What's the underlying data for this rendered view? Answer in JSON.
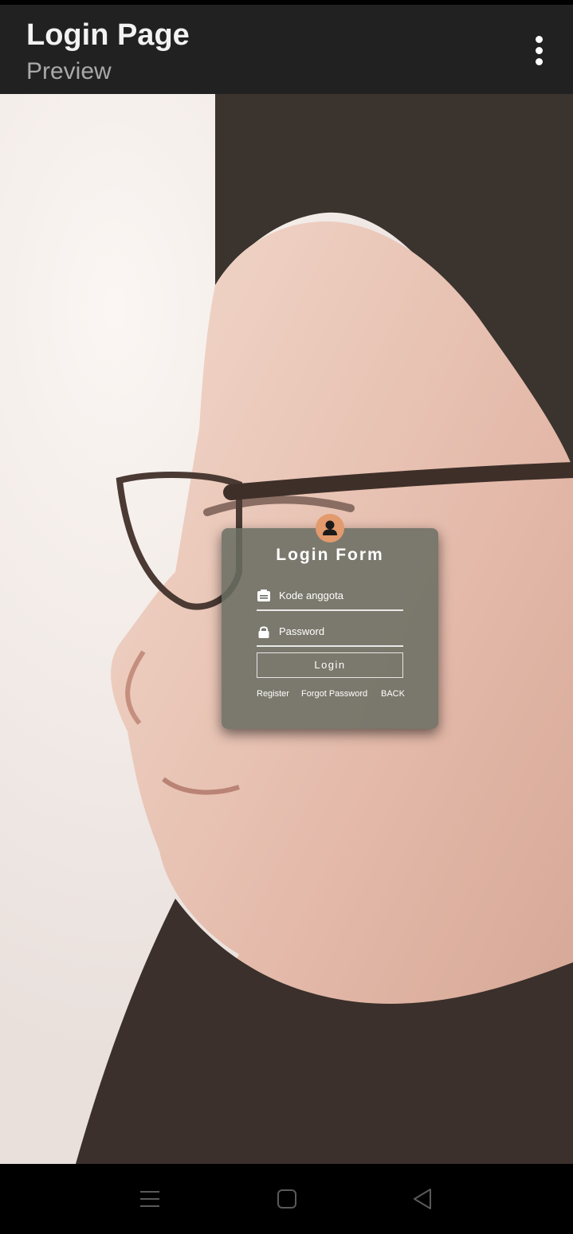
{
  "app": {
    "title": "Login Page",
    "subtitle": "Preview"
  },
  "icons": {
    "menu": "more-vert-icon",
    "avatar": "person-icon",
    "member": "id-card-icon",
    "password": "lock-icon",
    "nav_recents": "recent-apps-icon",
    "nav_home": "home-icon",
    "nav_back": "back-icon"
  },
  "colors": {
    "appbar": "#212121",
    "avatar_bg": "#e39a6c",
    "card_bg": "#696c62"
  },
  "login_form": {
    "title": "Login Form",
    "member_code_placeholder": "Kode anggota",
    "password_placeholder": "Password",
    "login_button": "Login",
    "register_link": "Register",
    "forgot_password_link": "Forgot Password",
    "back_link": "BACK"
  }
}
